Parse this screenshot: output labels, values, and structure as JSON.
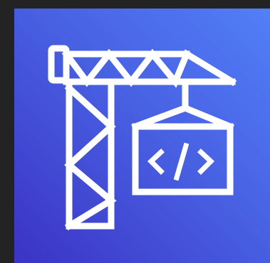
{
  "icon": {
    "name": "developer-tools-crane-icon",
    "background_gradient": [
      "#3b33c4",
      "#4861e3",
      "#527ff8"
    ],
    "stroke_color": "#ffffff",
    "page_background": "#232323"
  }
}
